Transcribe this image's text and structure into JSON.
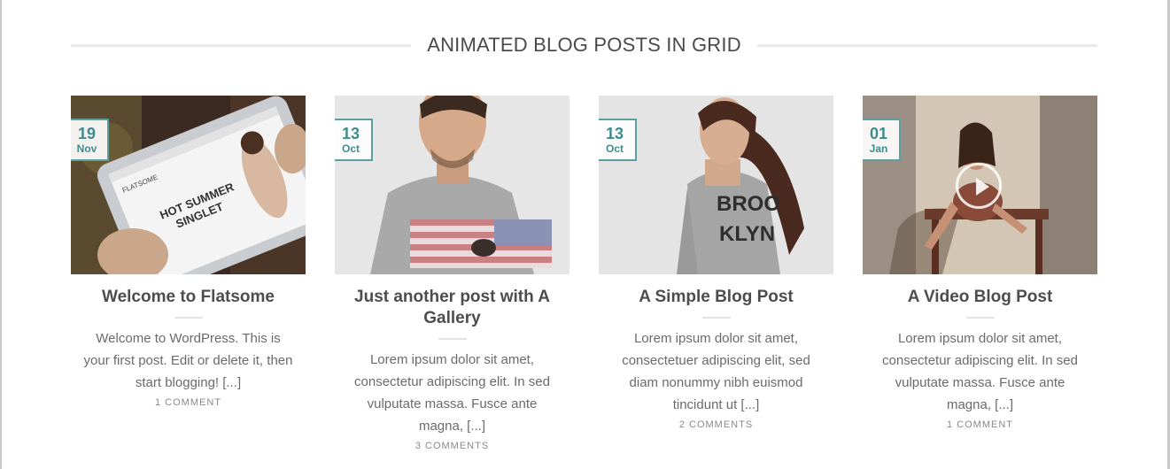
{
  "section": {
    "title": "ANIMATED BLOG POSTS IN GRID"
  },
  "posts": [
    {
      "day": "19",
      "month": "Nov",
      "title": "Welcome to Flatsome",
      "excerpt": "Welcome to WordPress. This is your first post. Edit or delete it, then start blogging! [...]",
      "comments": "1 COMMENT",
      "image": {
        "brand": "FLATSOME",
        "headline_1": "HOT SUMMER",
        "headline_2": "SINGLET"
      }
    },
    {
      "day": "13",
      "month": "Oct",
      "title": "Just another post with A Gallery",
      "excerpt": "Lorem ipsum dolor sit amet, consectetur adipiscing elit. In sed vulputate massa. Fusce ante magna, [...]",
      "comments": "3 COMMENTS"
    },
    {
      "day": "13",
      "month": "Oct",
      "title": "A Simple Blog Post",
      "excerpt": "Lorem ipsum dolor sit amet, consectetuer adipiscing elit, sed diam nonummy nibh euismod tincidunt ut [...]",
      "comments": "2 COMMENTS",
      "image": {
        "shirt_line_1": "BROO",
        "shirt_line_2": "KLYN"
      }
    },
    {
      "day": "01",
      "month": "Jan",
      "title": "A Video Blog Post",
      "excerpt": "Lorem ipsum dolor sit amet, consectetur adipiscing elit. In sed vulputate massa. Fusce ante magna, [...]",
      "comments": "1 COMMENT"
    }
  ],
  "colors": {
    "accent": "#5b9fa1",
    "title": "#4d4d4d",
    "excerpt": "#6b6b6b"
  }
}
